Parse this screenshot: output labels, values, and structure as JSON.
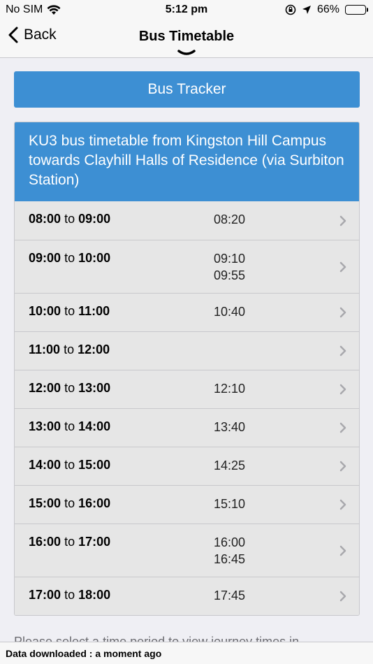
{
  "status_bar": {
    "carrier": "No SIM",
    "time": "5:12 pm",
    "battery": "66%",
    "battery_level": 0.66
  },
  "nav": {
    "back_label": "Back",
    "title": "Bus Timetable"
  },
  "tracker_button": "Bus Tracker",
  "timetable": {
    "header": "KU3 bus timetable from Kingston Hill Campus towards Clayhill Halls of Residence (via Surbiton Station)",
    "to_word": "to",
    "rows": [
      {
        "start": "08:00",
        "end": "09:00",
        "times": [
          "08:20"
        ]
      },
      {
        "start": "09:00",
        "end": "10:00",
        "times": [
          "09:10",
          "09:55"
        ]
      },
      {
        "start": "10:00",
        "end": "11:00",
        "times": [
          "10:40"
        ]
      },
      {
        "start": "11:00",
        "end": "12:00",
        "times": []
      },
      {
        "start": "12:00",
        "end": "13:00",
        "times": [
          "12:10"
        ]
      },
      {
        "start": "13:00",
        "end": "14:00",
        "times": [
          "13:40"
        ]
      },
      {
        "start": "14:00",
        "end": "15:00",
        "times": [
          "14:25"
        ]
      },
      {
        "start": "15:00",
        "end": "16:00",
        "times": [
          "15:10"
        ]
      },
      {
        "start": "16:00",
        "end": "17:00",
        "times": [
          "16:00",
          "16:45"
        ]
      },
      {
        "start": "17:00",
        "end": "18:00",
        "times": [
          "17:45"
        ]
      }
    ]
  },
  "hint": "Please select a time period to view journey times in",
  "footer": "Data downloaded : a moment ago"
}
